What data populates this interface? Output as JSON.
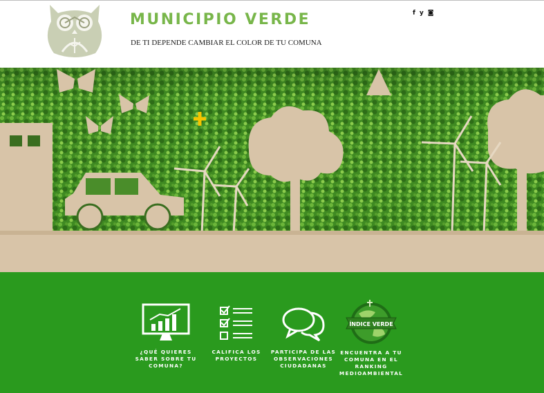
{
  "header": {
    "brand": "MUNICIPIO VERDE",
    "tagline": "DE TI DEPENDE CAMBIAR EL COLOR DE TU COMUNA",
    "social": [
      {
        "name": "facebook",
        "glyph": "f"
      },
      {
        "name": "twitter",
        "glyph": "y"
      },
      {
        "name": "instagram",
        "glyph": "◙"
      }
    ]
  },
  "features": [
    {
      "label": "¿Qué quieres saber sobre tu comuna?",
      "icon": "chart-monitor-icon"
    },
    {
      "label": "Califica los proyectos",
      "icon": "checklist-icon"
    },
    {
      "label": "Participa de las observaciones ciudadanas",
      "icon": "chat-bubbles-icon"
    },
    {
      "label": "Encuentra a tu comuna en el ranking medioambiental",
      "icon": "globe-index-icon",
      "badge": "ÍNDICE VERDE"
    }
  ],
  "colors": {
    "brand_green": "#78b64a",
    "panel_green": "#2a9a1e",
    "paper": "#d8c4a8",
    "accent_plus": "#f5c400"
  }
}
